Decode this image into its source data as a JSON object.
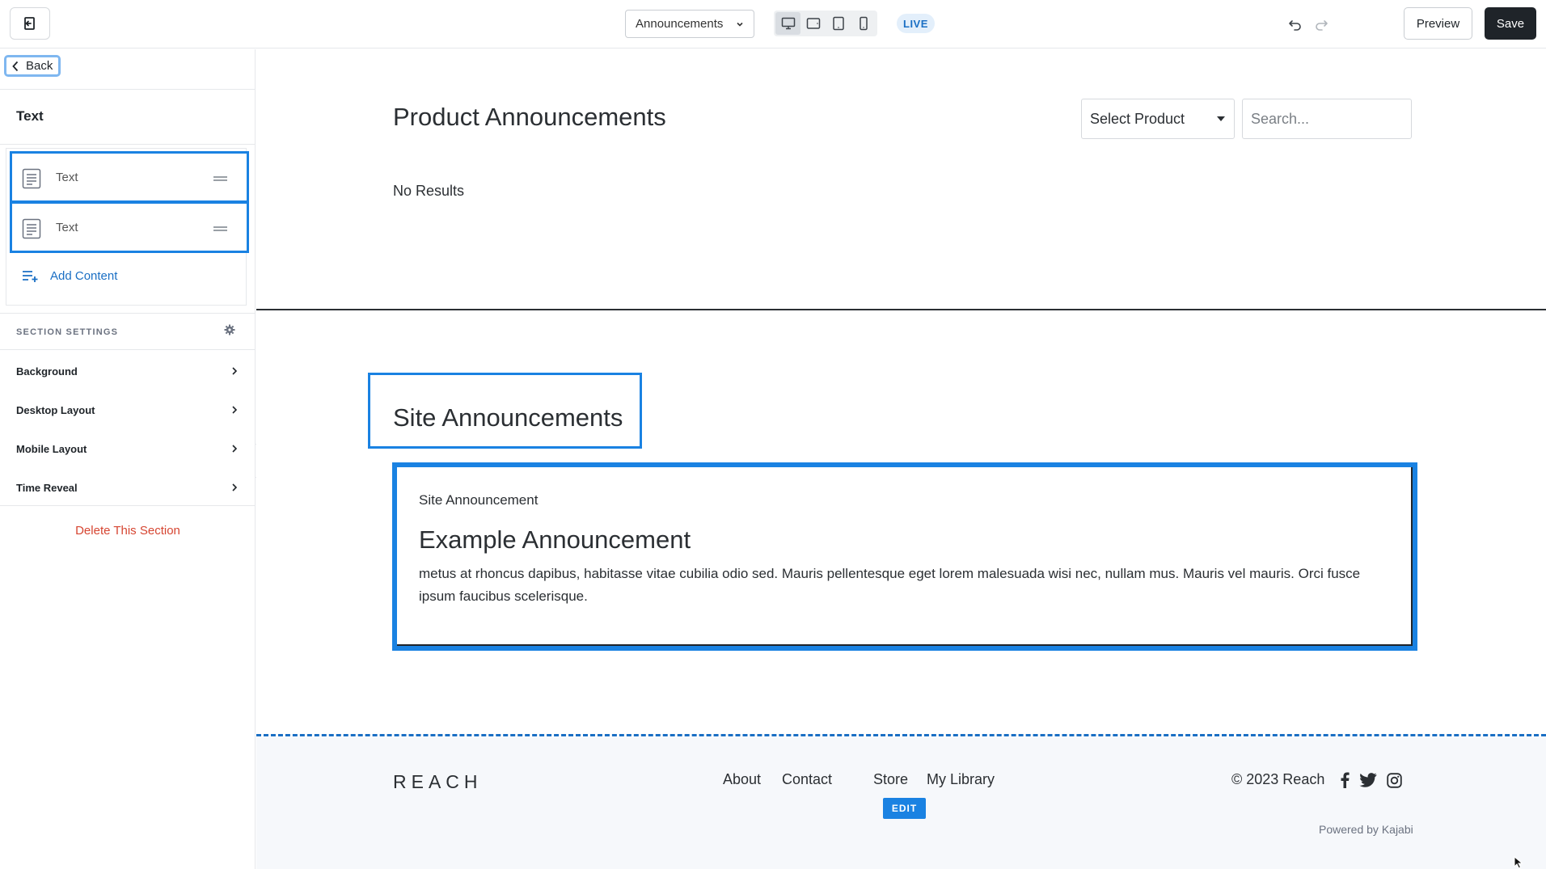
{
  "topbar": {
    "page_select_value": "Announcements",
    "live_badge": "LIVE",
    "preview_label": "Preview",
    "save_label": "Save"
  },
  "sidebar": {
    "back_label": "Back",
    "title": "Text",
    "blocks": [
      {
        "label": "Text"
      },
      {
        "label": "Text"
      }
    ],
    "add_content_label": "Add Content",
    "section_settings_label": "SECTION SETTINGS",
    "settings_items": [
      {
        "label": "Background"
      },
      {
        "label": "Desktop Layout"
      },
      {
        "label": "Mobile Layout"
      },
      {
        "label": "Time Reveal"
      }
    ],
    "delete_label": "Delete This Section"
  },
  "canvas": {
    "page_title": "Product Announcements",
    "product_select_value": "Select Product",
    "search_placeholder": "Search...",
    "no_results": "No Results",
    "site_title": "Site Announcements",
    "announcement": {
      "tag": "Site Announcement",
      "title": "Example Announcement",
      "body": "metus at rhoncus dapibus, habitasse vitae cubilia odio sed. Mauris pellentesque eget lorem malesuada wisi nec, nullam mus. Mauris vel mauris. Orci fusce ipsum faucibus scelerisque."
    }
  },
  "footer": {
    "brand": "REACH",
    "links": [
      "About",
      "Contact",
      "Store",
      "My Library"
    ],
    "edit_badge": "EDIT",
    "copyright": "© 2023 Reach",
    "powered_by": "Powered by Kajabi",
    "social_icons": [
      "facebook-icon",
      "twitter-icon",
      "instagram-icon"
    ]
  },
  "colors": {
    "accent": "#1a82e2",
    "save_bg": "#1f2429",
    "delete": "#d64531",
    "live_text": "#1a6fc4"
  }
}
